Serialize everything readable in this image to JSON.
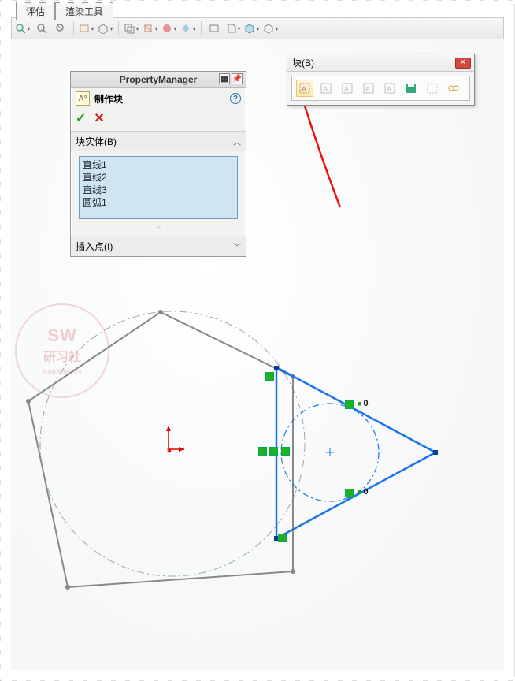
{
  "tabs": {
    "eval": "评估",
    "render": "渲染工具"
  },
  "property_manager": {
    "title": "PropertyManager",
    "feature_name": "制作块",
    "help": "?",
    "ok": "✓",
    "cancel": "✕",
    "group_entities": "块实体(B)",
    "entities": [
      "直线1",
      "直线2",
      "直线3",
      "圆弧1"
    ],
    "group_insert_point": "插入点(I)"
  },
  "block_popup": {
    "title": "块(B)"
  },
  "watermark": {
    "code": "SW",
    "text": "研习社",
    "brand": "SolidWorks"
  },
  "sketch_labels": {
    "zero1": "0",
    "zero2": "0"
  }
}
